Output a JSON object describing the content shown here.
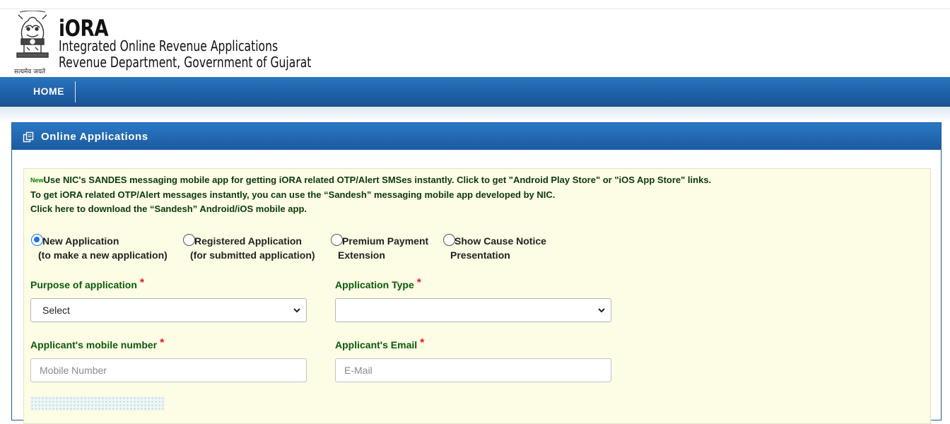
{
  "header": {
    "title": "iORA",
    "subtitle1": "Integrated Online Revenue Applications",
    "subtitle2": "Revenue Department, Government of Gujarat",
    "emblem_caption": "सत्यमेव जयते"
  },
  "nav": {
    "home_label": "HOME"
  },
  "panel": {
    "title": "Online Applications",
    "icon": "copy-icon"
  },
  "notice": {
    "badge": "New",
    "line1": "Use NIC's SANDES messaging mobile app for getting iORA related OTP/Alert SMSes instantly. Click to get \"Android Play Store\" or \"iOS App Store\" links.",
    "line2": "To get iORA related OTP/Alert messages instantly, you can use the “Sandesh” messaging mobile app developed by NIC.",
    "line3": "Click here to download the “Sandesh” Android/iOS mobile app."
  },
  "radio_options": [
    {
      "label": "New Application",
      "sub": "(to make a new application)",
      "checked": true
    },
    {
      "label": "Registered Application",
      "sub": "(for submitted application)",
      "checked": false
    },
    {
      "label": "Premium Payment",
      "sub": "Extension",
      "checked": false
    },
    {
      "label": "Show Cause Notice",
      "sub": "Presentation",
      "checked": false
    }
  ],
  "form": {
    "purpose_label": "Purpose of application",
    "purpose_value": "Select",
    "app_type_label": "Application Type",
    "app_type_value": "",
    "mobile_label": "Applicant's mobile number",
    "mobile_placeholder": "Mobile Number",
    "email_label": "Applicant's Email",
    "email_placeholder": "E-Mail",
    "required_mark": "*"
  },
  "colors": {
    "nav_blue": "#1e5fa6",
    "label_green": "#0b5a0b",
    "required_red": "#e01b1b",
    "content_bg": "#fdfde5"
  }
}
